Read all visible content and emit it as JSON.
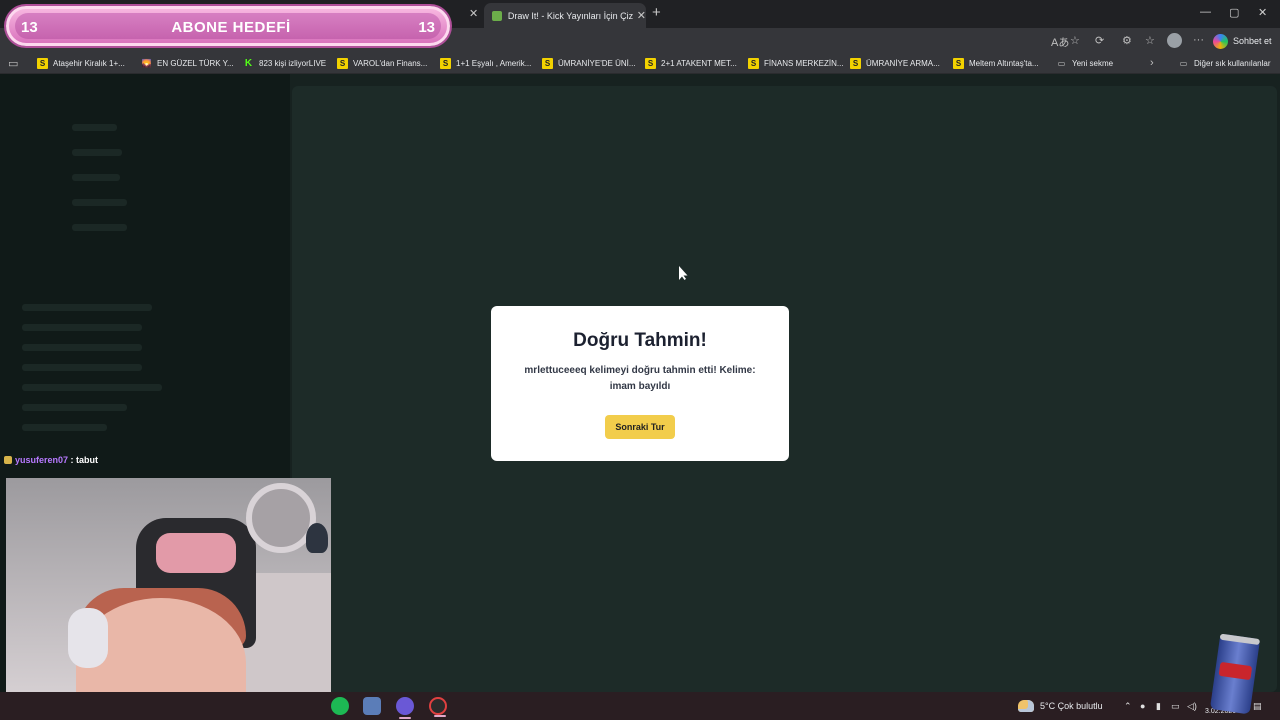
{
  "browser": {
    "active_tab_title": "Draw It! - Kick Yayınları İçin Çizim Oyunu",
    "new_tab_symbol": "+",
    "close_symbol": "✕",
    "window_controls": [
      "—",
      "▢",
      "✕"
    ],
    "copilot_label": "Sohbet et",
    "bookmarks": [
      {
        "label": "Ataşehir Kiralık 1+...",
        "icon": "S"
      },
      {
        "label": "EN GÜZEL TÜRK Y...",
        "icon": "🌄"
      },
      {
        "label": "823 kişi izliyorLIVE",
        "icon": "K"
      },
      {
        "label": "VAROL'dan Finans...",
        "icon": "S"
      },
      {
        "label": "1+1 Eşyalı , Amerik...",
        "icon": "S"
      },
      {
        "label": "ÜMRANİYE'DE ÜNİ...",
        "icon": "S"
      },
      {
        "label": "2+1 ATAKENT MET...",
        "icon": "S"
      },
      {
        "label": "FİNANS MERKEZİN...",
        "icon": "S"
      },
      {
        "label": "ÜMRANİYE ARMA...",
        "icon": "S"
      },
      {
        "label": "Meltem Altıntaş'ta...",
        "icon": "S"
      },
      {
        "label": "Yeni sekme",
        "icon": "▭"
      }
    ],
    "other_bookmarks": "Diğer sık kullanılanlar"
  },
  "overlay": {
    "goal_left": "13",
    "goal_title": "ABONE HEDEFİ",
    "goal_right": "13"
  },
  "chat": [
    {
      "user": "yusuferen07",
      "message": " : tabut"
    }
  ],
  "dialog": {
    "title": "Doğru Tahmin!",
    "message": "mrlettuceeeq kelimeyi doğru tahmin etti! Kelime: imam bayıldı",
    "button": "Sonraki Tur"
  },
  "taskbar": {
    "weather": "5°C  Çok bulutlu",
    "time": "19:",
    "date": "3.02.2026"
  },
  "colors": {
    "dialog_button": "#f2cd4b",
    "chat_username": "#b779ff",
    "page_background": "#172220"
  }
}
